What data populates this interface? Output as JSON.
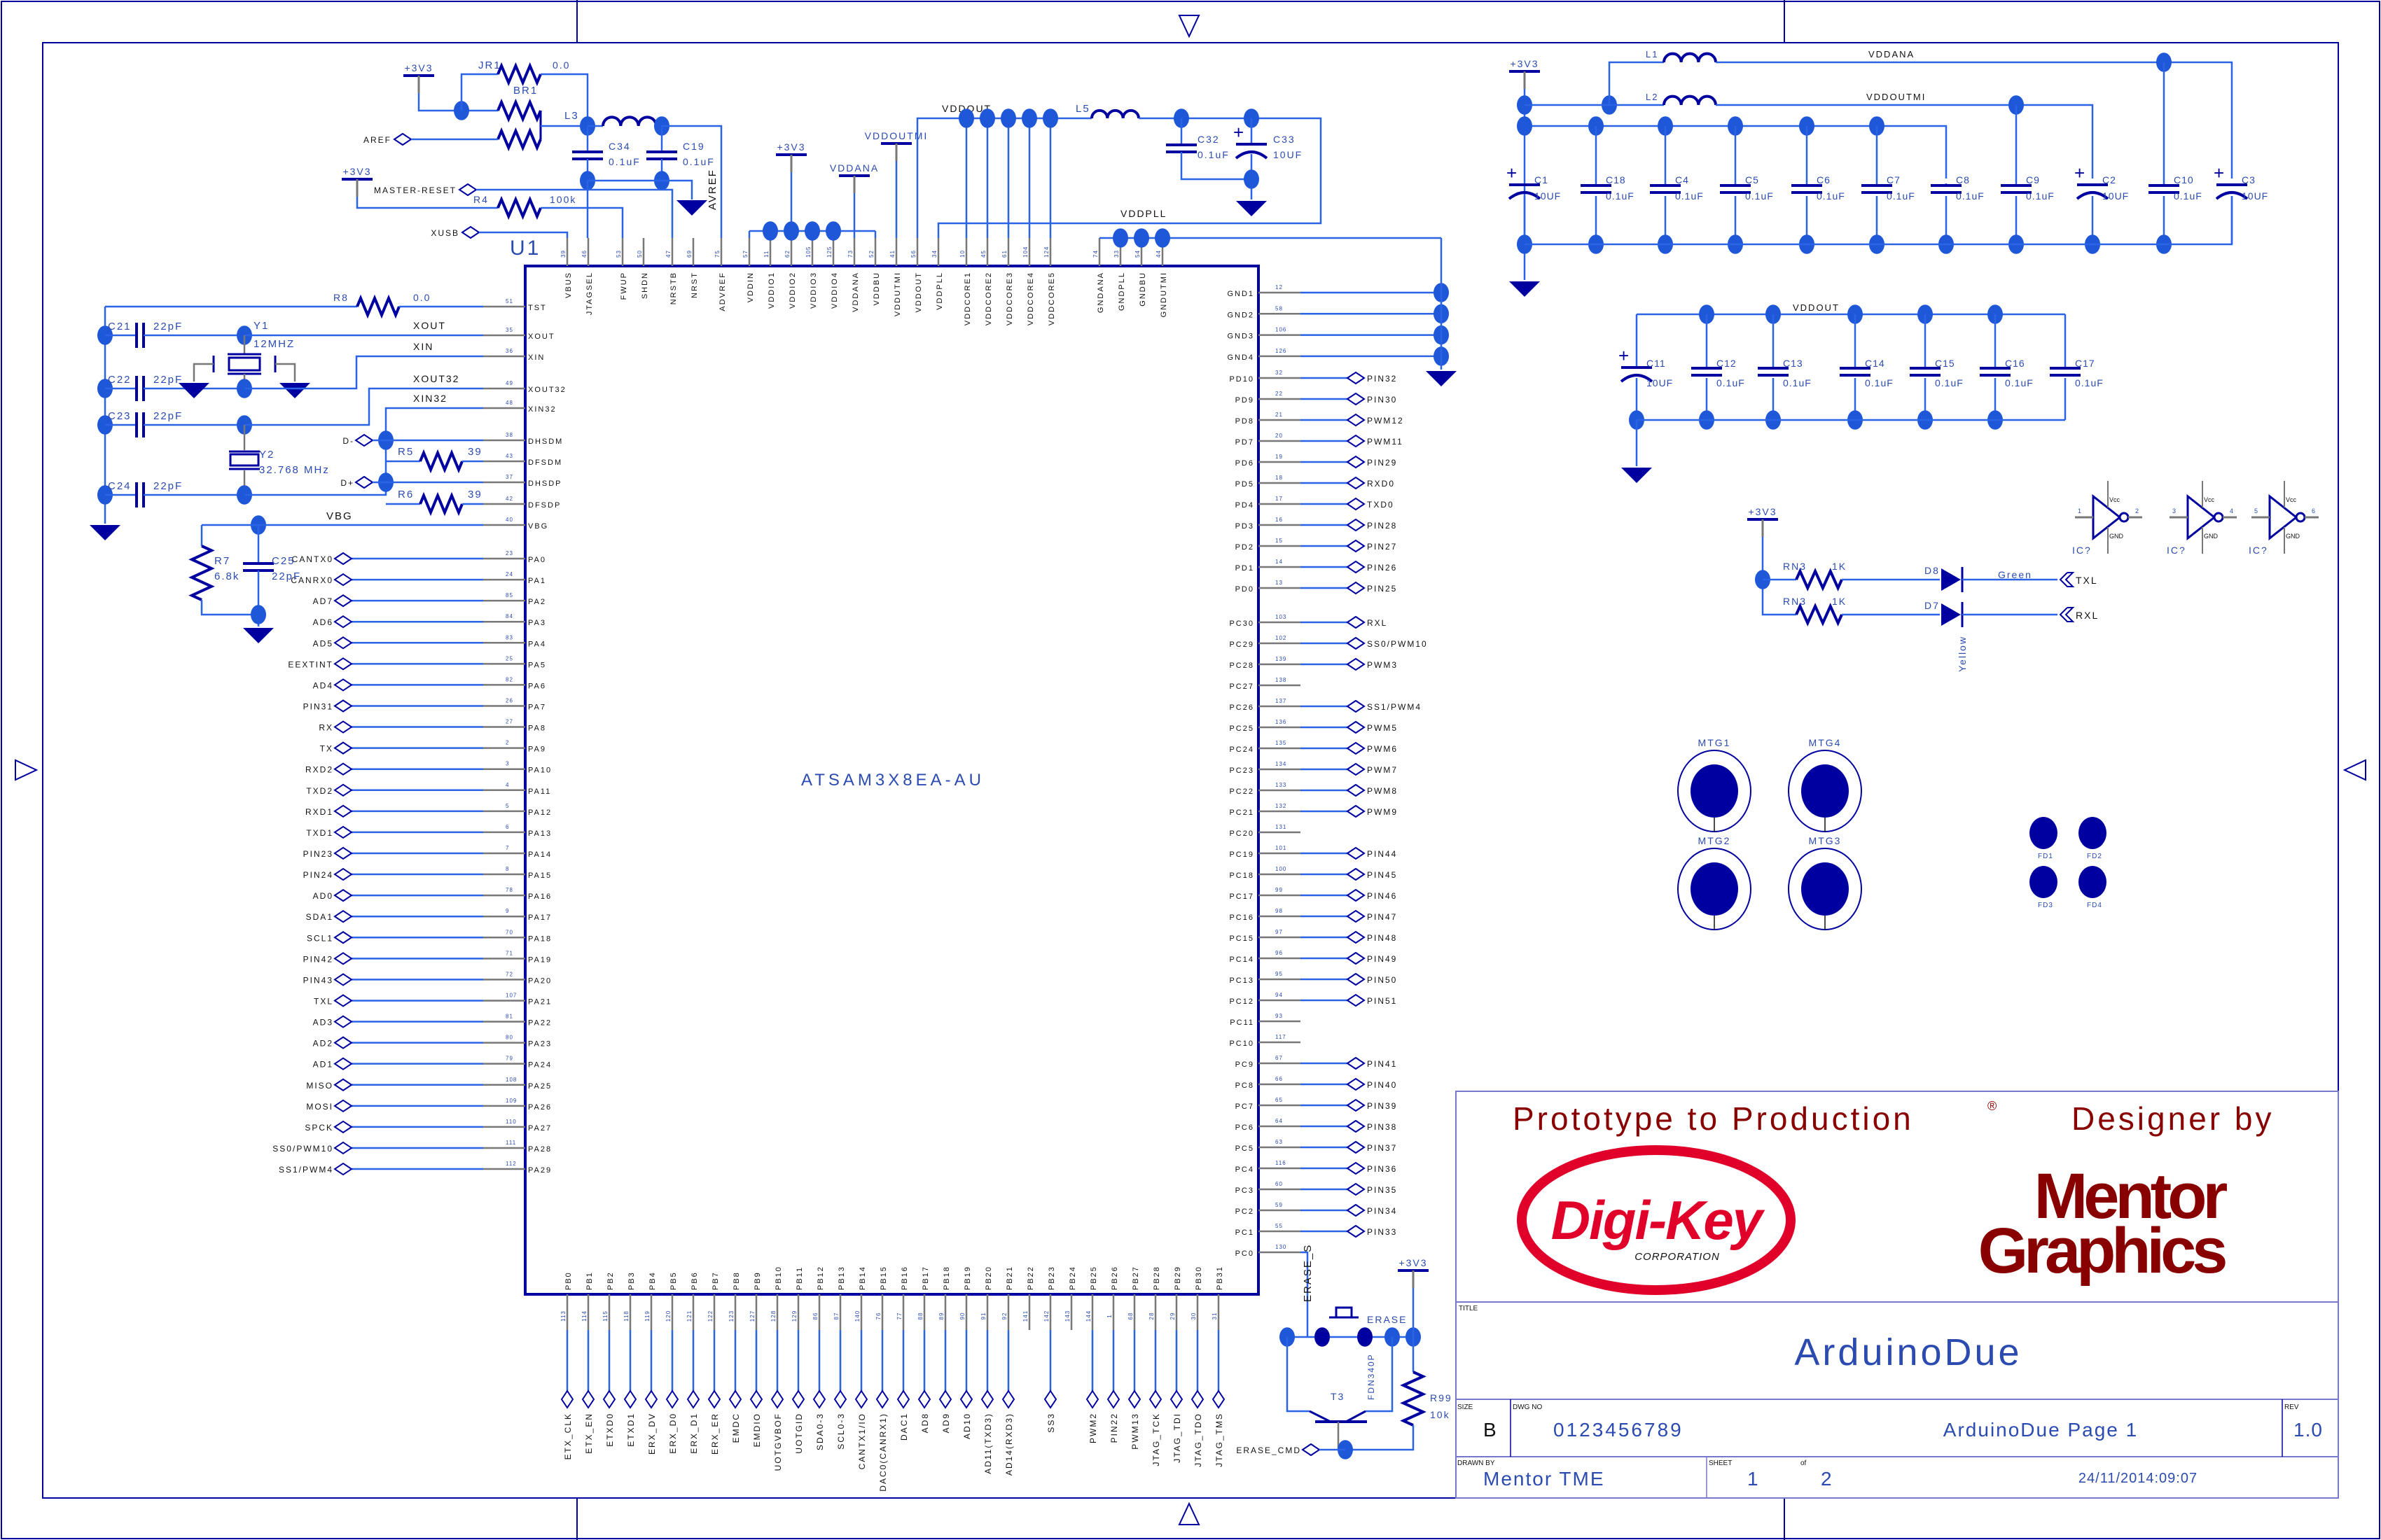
{
  "colors": {
    "wire": "#2a63e6",
    "symbol": "#0000a0",
    "junction": "#1f57d9",
    "stub": "#777777",
    "text": "#111111",
    "label": "#2b4bb0",
    "frame": "#7777cc",
    "digikey_red": "#e0002a",
    "mentor_red": "#880000"
  },
  "chip": {
    "ref": "U1",
    "part": "ATSAM3X8EA-AU",
    "left_pins": [
      {
        "name": "TST",
        "num": "51"
      },
      {
        "name": "XOUT",
        "num": "35"
      },
      {
        "name": "XIN",
        "num": "36"
      },
      {
        "name": "XOUT32",
        "num": "49"
      },
      {
        "name": "XIN32",
        "num": "48"
      },
      {
        "name": "DHSDM",
        "num": "38"
      },
      {
        "name": "DFSDM",
        "num": "43"
      },
      {
        "name": "DHSDP",
        "num": "37"
      },
      {
        "name": "DFSDP",
        "num": "42"
      },
      {
        "name": "VBG",
        "num": "40"
      },
      {
        "name": "PA0",
        "num": "23",
        "net": "CANTX0"
      },
      {
        "name": "PA1",
        "num": "24",
        "net": "CANRX0"
      },
      {
        "name": "PA2",
        "num": "85",
        "net": "AD7"
      },
      {
        "name": "PA3",
        "num": "84",
        "net": "AD6"
      },
      {
        "name": "PA4",
        "num": "83",
        "net": "AD5"
      },
      {
        "name": "PA5",
        "num": "25",
        "net": "EEXTINT"
      },
      {
        "name": "PA6",
        "num": "82",
        "net": "AD4"
      },
      {
        "name": "PA7",
        "num": "26",
        "net": "PIN31"
      },
      {
        "name": "PA8",
        "num": "27",
        "net": "RX"
      },
      {
        "name": "PA9",
        "num": "2",
        "net": "TX"
      },
      {
        "name": "PA10",
        "num": "3",
        "net": "RXD2"
      },
      {
        "name": "PA11",
        "num": "4",
        "net": "TXD2"
      },
      {
        "name": "PA12",
        "num": "5",
        "net": "RXD1"
      },
      {
        "name": "PA13",
        "num": "6",
        "net": "TXD1"
      },
      {
        "name": "PA14",
        "num": "7",
        "net": "PIN23"
      },
      {
        "name": "PA15",
        "num": "8",
        "net": "PIN24"
      },
      {
        "name": "PA16",
        "num": "78",
        "net": "AD0"
      },
      {
        "name": "PA17",
        "num": "9",
        "net": "SDA1"
      },
      {
        "name": "PA18",
        "num": "70",
        "net": "SCL1"
      },
      {
        "name": "PA19",
        "num": "71",
        "net": "PIN42"
      },
      {
        "name": "PA20",
        "num": "72",
        "net": "PIN43"
      },
      {
        "name": "PA21",
        "num": "107",
        "net": "TXL"
      },
      {
        "name": "PA22",
        "num": "81",
        "net": "AD3"
      },
      {
        "name": "PA23",
        "num": "80",
        "net": "AD2"
      },
      {
        "name": "PA24",
        "num": "79",
        "net": "AD1"
      },
      {
        "name": "PA25",
        "num": "108",
        "net": "MISO"
      },
      {
        "name": "PA26",
        "num": "109",
        "net": "MOSI"
      },
      {
        "name": "PA27",
        "num": "110",
        "net": "SPCK"
      },
      {
        "name": "PA28",
        "num": "111",
        "net": "SS0/PWM10"
      },
      {
        "name": "PA29",
        "num": "112",
        "net": "SS1/PWM4"
      }
    ],
    "right_pins_gnd": [
      {
        "name": "GND1",
        "num": "12"
      },
      {
        "name": "GND2",
        "num": "58"
      },
      {
        "name": "GND3",
        "num": "106"
      },
      {
        "name": "GND4",
        "num": "126"
      }
    ],
    "right_pins_pd": [
      {
        "name": "PD10",
        "num": "32",
        "net": "PIN32"
      },
      {
        "name": "PD9",
        "num": "22",
        "net": "PIN30"
      },
      {
        "name": "PD8",
        "num": "21",
        "net": "PWM12"
      },
      {
        "name": "PD7",
        "num": "20",
        "net": "PWM11"
      },
      {
        "name": "PD6",
        "num": "19",
        "net": "PIN29"
      },
      {
        "name": "PD5",
        "num": "18",
        "net": "RXD0"
      },
      {
        "name": "PD4",
        "num": "17",
        "net": "TXD0"
      },
      {
        "name": "PD3",
        "num": "16",
        "net": "PIN28"
      },
      {
        "name": "PD2",
        "num": "15",
        "net": "PIN27"
      },
      {
        "name": "PD1",
        "num": "14",
        "net": "PIN26"
      },
      {
        "name": "PD0",
        "num": "13",
        "net": "PIN25"
      }
    ],
    "right_pins_pc": [
      {
        "name": "PC30",
        "num": "103",
        "net": "RXL"
      },
      {
        "name": "PC29",
        "num": "102",
        "net": "SS0/PWM10"
      },
      {
        "name": "PC28",
        "num": "139",
        "net": "PWM3"
      },
      {
        "name": "PC27",
        "num": "138"
      },
      {
        "name": "PC26",
        "num": "137",
        "net": "SS1/PWM4"
      },
      {
        "name": "PC25",
        "num": "136",
        "net": "PWM5"
      },
      {
        "name": "PC24",
        "num": "135",
        "net": "PWM6"
      },
      {
        "name": "PC23",
        "num": "134",
        "net": "PWM7"
      },
      {
        "name": "PC22",
        "num": "133",
        "net": "PWM8"
      },
      {
        "name": "PC21",
        "num": "132",
        "net": "PWM9"
      },
      {
        "name": "PC20",
        "num": "131"
      },
      {
        "name": "PC19",
        "num": "101",
        "net": "PIN44"
      },
      {
        "name": "PC18",
        "num": "100",
        "net": "PIN45"
      },
      {
        "name": "PC17",
        "num": "99",
        "net": "PIN46"
      },
      {
        "name": "PC16",
        "num": "98",
        "net": "PIN47"
      },
      {
        "name": "PC15",
        "num": "97",
        "net": "PIN48"
      },
      {
        "name": "PC14",
        "num": "96",
        "net": "PIN49"
      },
      {
        "name": "PC13",
        "num": "95",
        "net": "PIN50"
      },
      {
        "name": "PC12",
        "num": "94",
        "net": "PIN51"
      },
      {
        "name": "PC11",
        "num": "93"
      },
      {
        "name": "PC10",
        "num": "117"
      },
      {
        "name": "PC9",
        "num": "67",
        "net": "PIN41"
      },
      {
        "name": "PC8",
        "num": "66",
        "net": "PIN40"
      },
      {
        "name": "PC7",
        "num": "65",
        "net": "PIN39"
      },
      {
        "name": "PC6",
        "num": "64",
        "net": "PIN38"
      },
      {
        "name": "PC5",
        "num": "63",
        "net": "PIN37"
      },
      {
        "name": "PC4",
        "num": "116",
        "net": "PIN36"
      },
      {
        "name": "PC3",
        "num": "60",
        "net": "PIN35"
      },
      {
        "name": "PC2",
        "num": "59",
        "net": "PIN34"
      },
      {
        "name": "PC1",
        "num": "55",
        "net": "PIN33"
      },
      {
        "name": "PC0",
        "num": "130"
      }
    ],
    "top_pins": [
      {
        "name": "VBUS",
        "num": "39"
      },
      {
        "name": "JTAGSEL",
        "num": "46"
      },
      {
        "name": "FWUP",
        "num": "53"
      },
      {
        "name": "SHDN",
        "num": "50"
      },
      {
        "name": "NRSTB",
        "num": "47"
      },
      {
        "name": "NRST",
        "num": "69"
      },
      {
        "name": "ADVREF",
        "num": "75"
      },
      {
        "name": "VDDIN",
        "num": "57"
      },
      {
        "name": "VDDIO1",
        "num": "11"
      },
      {
        "name": "VDDIO2",
        "num": "62"
      },
      {
        "name": "VDDIO3",
        "num": "105"
      },
      {
        "name": "VDDIO4",
        "num": "125"
      },
      {
        "name": "VDDANA",
        "num": "73"
      },
      {
        "name": "VDDBU",
        "num": "52"
      },
      {
        "name": "VDDUTMI",
        "num": "41"
      },
      {
        "name": "VDDOUT",
        "num": "56"
      },
      {
        "name": "VDDPLL",
        "num": "34"
      },
      {
        "name": "VDDCORE1",
        "num": "10"
      },
      {
        "name": "VDDCORE2",
        "num": "45"
      },
      {
        "name": "VDDCORE3",
        "num": "61"
      },
      {
        "name": "VDDCORE4",
        "num": "104"
      },
      {
        "name": "VDDCORE5",
        "num": "124"
      },
      {
        "name": "GNDANA",
        "num": "74"
      },
      {
        "name": "GNDPLL",
        "num": "33"
      },
      {
        "name": "GNDBU",
        "num": "54"
      },
      {
        "name": "GNDUTMI",
        "num": "44"
      }
    ],
    "bottom_pins": [
      {
        "name": "PB0",
        "num": "113",
        "net": "ETX_CLK"
      },
      {
        "name": "PB1",
        "num": "114",
        "net": "ETX_EN"
      },
      {
        "name": "PB2",
        "num": "115",
        "net": "ETXD0"
      },
      {
        "name": "PB3",
        "num": "118",
        "net": "ETXD1"
      },
      {
        "name": "PB4",
        "num": "119",
        "net": "ERX_DV"
      },
      {
        "name": "PB5",
        "num": "120",
        "net": "ERX_D0"
      },
      {
        "name": "PB6",
        "num": "121",
        "net": "ERX_D1"
      },
      {
        "name": "PB7",
        "num": "122",
        "net": "ERX_ER"
      },
      {
        "name": "PB8",
        "num": "123",
        "net": "EMDC"
      },
      {
        "name": "PB9",
        "num": "127",
        "net": "EMDIO"
      },
      {
        "name": "PB10",
        "num": "128",
        "net": "UOTGVBOF"
      },
      {
        "name": "PB11",
        "num": "129",
        "net": "UOTGID"
      },
      {
        "name": "PB12",
        "num": "86",
        "net": "SDA0-3"
      },
      {
        "name": "PB13",
        "num": "87",
        "net": "SCL0-3"
      },
      {
        "name": "PB14",
        "num": "140",
        "net": "CANTX1/IO"
      },
      {
        "name": "PB15",
        "num": "76",
        "net": "DAC0(CANRX1)"
      },
      {
        "name": "PB16",
        "num": "77",
        "net": "DAC1"
      },
      {
        "name": "PB17",
        "num": "88",
        "net": "AD8"
      },
      {
        "name": "PB18",
        "num": "89",
        "net": "AD9"
      },
      {
        "name": "PB19",
        "num": "90",
        "net": "AD10"
      },
      {
        "name": "PB20",
        "num": "91",
        "net": "AD11(TXD3)"
      },
      {
        "name": "PB21",
        "num": "92",
        "net": "AD14(RXD3)"
      },
      {
        "name": "PB22",
        "num": "141"
      },
      {
        "name": "PB23",
        "num": "142",
        "net": "SS3"
      },
      {
        "name": "PB24",
        "num": "143"
      },
      {
        "name": "PB25",
        "num": "144",
        "net": "PWM2"
      },
      {
        "name": "PB26",
        "num": "1",
        "net": "PIN22"
      },
      {
        "name": "PB27",
        "num": "68",
        "net": "PWM13"
      },
      {
        "name": "PB28",
        "num": "28",
        "net": "JTAG_TCK"
      },
      {
        "name": "PB29",
        "num": "29",
        "net": "JTAG_TDI"
      },
      {
        "name": "PB30",
        "num": "30",
        "net": "JTAG_TDO"
      },
      {
        "name": "PB31",
        "num": "31",
        "net": "JTAG_TMS"
      }
    ]
  },
  "nets": {
    "pwr_3v3": "+3V3",
    "aref": "AREF",
    "master_reset": "MASTER-RESET",
    "xusb": "XUSB",
    "avref": "AVREF",
    "vddana": "VDDANA",
    "vddoutmi": "VDDOUTMI",
    "vddout": "VDDOUT",
    "vddpll": "VDDPLL",
    "xout": "XOUT",
    "xin": "XIN",
    "xout32": "XOUT32",
    "xin32": "XIN32",
    "dm": "D-",
    "dp": "D+",
    "vbg": "VBG",
    "txl": "TXL",
    "rxl": "RXL",
    "erase_s": "ERASE_S",
    "erase_cmd": "ERASE_CMD"
  },
  "components": {
    "JR1": {
      "ref": "JR1",
      "value": "0.0"
    },
    "BR1": {
      "ref": "BR1"
    },
    "L3": {
      "ref": "L3"
    },
    "C34": {
      "ref": "C34",
      "value": "0.1uF"
    },
    "C19": {
      "ref": "C19",
      "value": "0.1uF"
    },
    "R4": {
      "ref": "R4",
      "value": "100k"
    },
    "R8": {
      "ref": "R8",
      "value": "0.0"
    },
    "C21": {
      "ref": "C21",
      "value": "22pF"
    },
    "C22": {
      "ref": "C22",
      "value": "22pF"
    },
    "C23": {
      "ref": "C23",
      "value": "22pF"
    },
    "C24": {
      "ref": "C24",
      "value": "22pF"
    },
    "Y1": {
      "ref": "Y1",
      "value": "12MHZ"
    },
    "Y2": {
      "ref": "Y2",
      "value": "32.768 MHz"
    },
    "R5": {
      "ref": "R5",
      "value": "39"
    },
    "R6": {
      "ref": "R6",
      "value": "39"
    },
    "R7": {
      "ref": "R7",
      "value": "6.8k"
    },
    "C25": {
      "ref": "C25",
      "value": "22pF"
    },
    "L5": {
      "ref": "L5"
    },
    "C32": {
      "ref": "C32",
      "value": "0.1uF"
    },
    "C33": {
      "ref": "C33",
      "value": "10UF"
    },
    "L1": {
      "ref": "L1"
    },
    "L2": {
      "ref": "L2"
    },
    "rail_caps": [
      {
        "ref": "C1",
        "value": "10UF",
        "polarized": true
      },
      {
        "ref": "C18",
        "value": "0.1uF"
      },
      {
        "ref": "C4",
        "value": "0.1uF"
      },
      {
        "ref": "C5",
        "value": "0.1uF"
      },
      {
        "ref": "C6",
        "value": "0.1uF"
      },
      {
        "ref": "C7",
        "value": "0.1uF"
      },
      {
        "ref": "C8",
        "value": "0.1uF"
      },
      {
        "ref": "C9",
        "value": "0.1uF"
      },
      {
        "ref": "C2",
        "value": "10UF",
        "polarized": true
      },
      {
        "ref": "C10",
        "value": "0.1uF"
      },
      {
        "ref": "C3",
        "value": "10UF",
        "polarized": true
      }
    ],
    "vddout_caps": [
      {
        "ref": "C11",
        "value": "10UF",
        "polarized": true
      },
      {
        "ref": "C12",
        "value": "0.1uF"
      },
      {
        "ref": "C13",
        "value": "0.1uF"
      },
      {
        "ref": "C14",
        "value": "0.1uF"
      },
      {
        "ref": "C15",
        "value": "0.1uF"
      },
      {
        "ref": "C16",
        "value": "0.1uF"
      },
      {
        "ref": "C17",
        "value": "0.1uF"
      }
    ],
    "RN3a": {
      "ref": "RN3",
      "value": "1K"
    },
    "RN3b": {
      "ref": "RN3",
      "value": "1K"
    },
    "D8": {
      "ref": "D8",
      "value": "Green"
    },
    "D7": {
      "ref": "D7",
      "value": "Yellow"
    },
    "inverters": [
      {
        "ref": "IC?",
        "in": "1",
        "out": "2",
        "vcc": "Vcc",
        "gnd": "GND"
      },
      {
        "ref": "IC?",
        "in": "3",
        "out": "4",
        "vcc": "Vcc",
        "gnd": "GND"
      },
      {
        "ref": "IC?",
        "in": "5",
        "out": "6",
        "vcc": "Vcc",
        "gnd": "GND"
      }
    ],
    "mounting": [
      "MTG1",
      "MTG4",
      "MTG2",
      "MTG3"
    ],
    "fiducials": [
      "FD1",
      "FD2",
      "FD3",
      "FD4"
    ],
    "T3": {
      "ref": "T3",
      "value": "FDN340P"
    },
    "R99": {
      "ref": "R99",
      "value": "10k"
    },
    "ERASE": {
      "ref": "ERASE"
    }
  },
  "title_block": {
    "tagline": "Prototype to Production",
    "registered": "®",
    "designer_by": "Designer by",
    "digikey_logo": "Digi-Key",
    "digikey_sub": "CORPORATION",
    "mentor_logo_1": "Mentor",
    "mentor_logo_2": "Graphics",
    "title_label": "TITLE",
    "title": "ArduinoDue",
    "size_label": "SIZE",
    "size": "B",
    "dwg_label": "DWG NO",
    "dwg_no": "0123456789",
    "page_name": "ArduinoDue Page 1",
    "rev_label": "REV",
    "rev": "1.0",
    "drawn_label": "DRAWN BY",
    "drawn_by": "Mentor TME",
    "sheet_label": "SHEET",
    "sheet": "1",
    "of_label": "of",
    "sheet_total": "2",
    "date": "24/11/2014:09:07"
  }
}
